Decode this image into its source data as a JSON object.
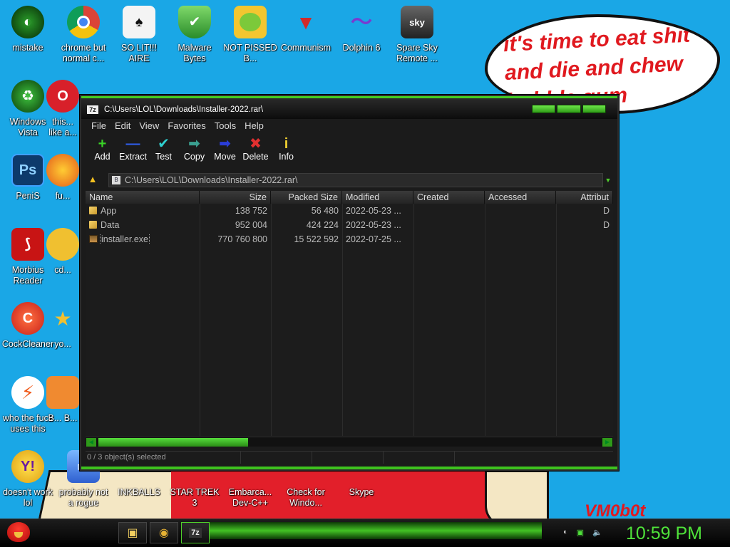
{
  "speech_bubble": {
    "text": "it's time to eat shit and die and chew bubble gum"
  },
  "watermark": "VM0b0t",
  "desktop_icons": [
    {
      "label": "mistake"
    },
    {
      "label": "chrome but normal c..."
    },
    {
      "label": "SO LIT!!! AIRE"
    },
    {
      "label": "Malware Bytes"
    },
    {
      "label": "NOT PISSED B..."
    },
    {
      "label": "Communism"
    },
    {
      "label": "Dolphin 6"
    },
    {
      "label": "Spare Sky Remote ..."
    },
    {
      "label": "Windows Vista"
    },
    {
      "label": "this... like a..."
    },
    {
      "label": "PeniS"
    },
    {
      "label": "fu..."
    },
    {
      "label": "Morbius Reader"
    },
    {
      "label": "cd..."
    },
    {
      "label": "CockCleaner"
    },
    {
      "label": "yo..."
    },
    {
      "label": "who the fuck uses this"
    },
    {
      "label": "B... B..."
    },
    {
      "label": "doesn't work lol"
    },
    {
      "label": "probably not a rogue"
    },
    {
      "label": "INKBALLS"
    },
    {
      "label": "STAR TREK 3"
    },
    {
      "label": "Embarca... Dev-C++"
    },
    {
      "label": "Check for Windo..."
    },
    {
      "label": "Skype"
    }
  ],
  "window": {
    "app_icon": "7z",
    "title": "C:\\Users\\LOL\\Downloads\\Installer-2022.rar\\",
    "menu": [
      "File",
      "Edit",
      "View",
      "Favorites",
      "Tools",
      "Help"
    ],
    "toolbar": [
      {
        "label": "Add",
        "glyph": "+",
        "color": "#39d426"
      },
      {
        "label": "Extract",
        "glyph": "—",
        "color": "#2f5ff0"
      },
      {
        "label": "Test",
        "glyph": "✔",
        "color": "#2fd0d0"
      },
      {
        "label": "Copy",
        "glyph": "➡",
        "color": "#3aa090"
      },
      {
        "label": "Move",
        "glyph": "➡",
        "color": "#2a3dd8"
      },
      {
        "label": "Delete",
        "glyph": "✖",
        "color": "#e23030"
      },
      {
        "label": "Info",
        "glyph": "i",
        "color": "#f0d030"
      }
    ],
    "address": "C:\\Users\\LOL\\Downloads\\Installer-2022.rar\\",
    "columns": [
      "Name",
      "Size",
      "Packed Size",
      "Modified",
      "Created",
      "Accessed",
      "Attribut"
    ],
    "rows": [
      {
        "name": "App",
        "size": "138 752",
        "packed": "56 480",
        "modified": "2022-05-23 ...",
        "created": "",
        "accessed": "",
        "attr": "D",
        "type": "folder"
      },
      {
        "name": "Data",
        "size": "952 004",
        "packed": "424 224",
        "modified": "2022-05-23 ...",
        "created": "",
        "accessed": "",
        "attr": "D",
        "type": "folder"
      },
      {
        "name": "installer.exe",
        "size": "770 760 800",
        "packed": "15 522 592",
        "modified": "2022-07-25 ...",
        "created": "",
        "accessed": "",
        "attr": "",
        "type": "exe"
      }
    ],
    "status": "0 / 3 object(s) selected"
  },
  "taskbar": {
    "buttons": [
      {
        "name": "explorer",
        "glyph": "▣",
        "color": "#f3d060"
      },
      {
        "name": "chrome",
        "glyph": "◉",
        "color": "#e9b434"
      },
      {
        "name": "7zip",
        "glyph": "7z",
        "color": "#eeeeee"
      }
    ],
    "clock": "10:59 PM"
  }
}
